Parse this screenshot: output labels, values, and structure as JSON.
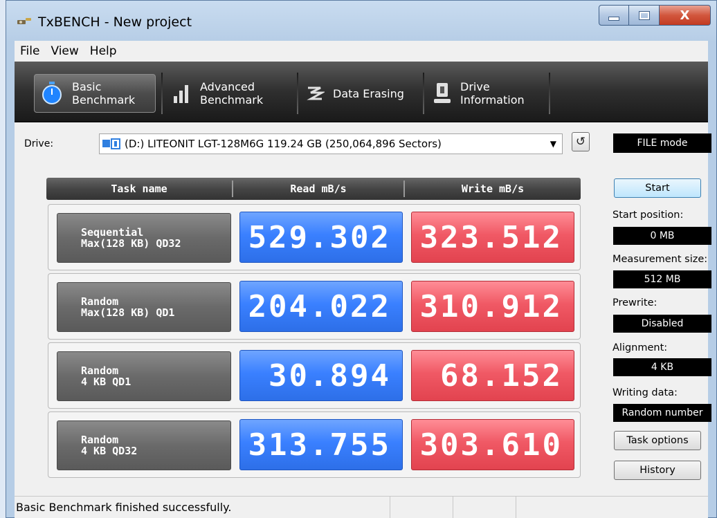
{
  "window": {
    "title": "TxBENCH - New project",
    "close_glyph": "X"
  },
  "menu": [
    "File",
    "View",
    "Help"
  ],
  "toolbar": {
    "basic": {
      "line1": "Basic",
      "line2": "Benchmark",
      "icon": "stopwatch-icon"
    },
    "advanced": {
      "line1": "Advanced",
      "line2": "Benchmark",
      "icon": "bar-chart-icon"
    },
    "erasing": {
      "label": "Data Erasing",
      "icon": "eraser-icon"
    },
    "drive": {
      "line1": "Drive",
      "line2": "Information",
      "icon": "drive-info-icon"
    }
  },
  "drive": {
    "label": "Drive:",
    "selected": "(D:) LITEONIT LGT-128M6G  119.24 GB (250,064,896 Sectors)",
    "mode": "FILE mode"
  },
  "table": {
    "headers": [
      "Task name",
      "Read mB/s",
      "Write mB/s"
    ],
    "rows": [
      {
        "task1": "Sequential",
        "task2": "Max(128 KB) QD32",
        "read": "529.302",
        "write": "323.512"
      },
      {
        "task1": "Random",
        "task2": "Max(128 KB) QD1",
        "read": "204.022",
        "write": "310.912"
      },
      {
        "task1": "Random",
        "task2": "4 KB QD1",
        "read": "30.894",
        "write": "68.152"
      },
      {
        "task1": "Random",
        "task2": "4 KB QD32",
        "read": "313.755",
        "write": "303.610"
      }
    ]
  },
  "side": {
    "start": "Start",
    "start_position_label": "Start position:",
    "start_position": "0 MB",
    "measurement_label": "Measurement size:",
    "measurement": "512 MB",
    "prewrite_label": "Prewrite:",
    "prewrite": "Disabled",
    "alignment_label": "Alignment:",
    "alignment": "4 KB",
    "writing_label": "Writing data:",
    "writing": "Random number",
    "task_options": "Task options",
    "history": "History"
  },
  "status": "Basic Benchmark finished successfully.",
  "colors": {
    "read": "#3a80ff",
    "write": "#f05965",
    "toolbar": "#2f2f2f"
  }
}
